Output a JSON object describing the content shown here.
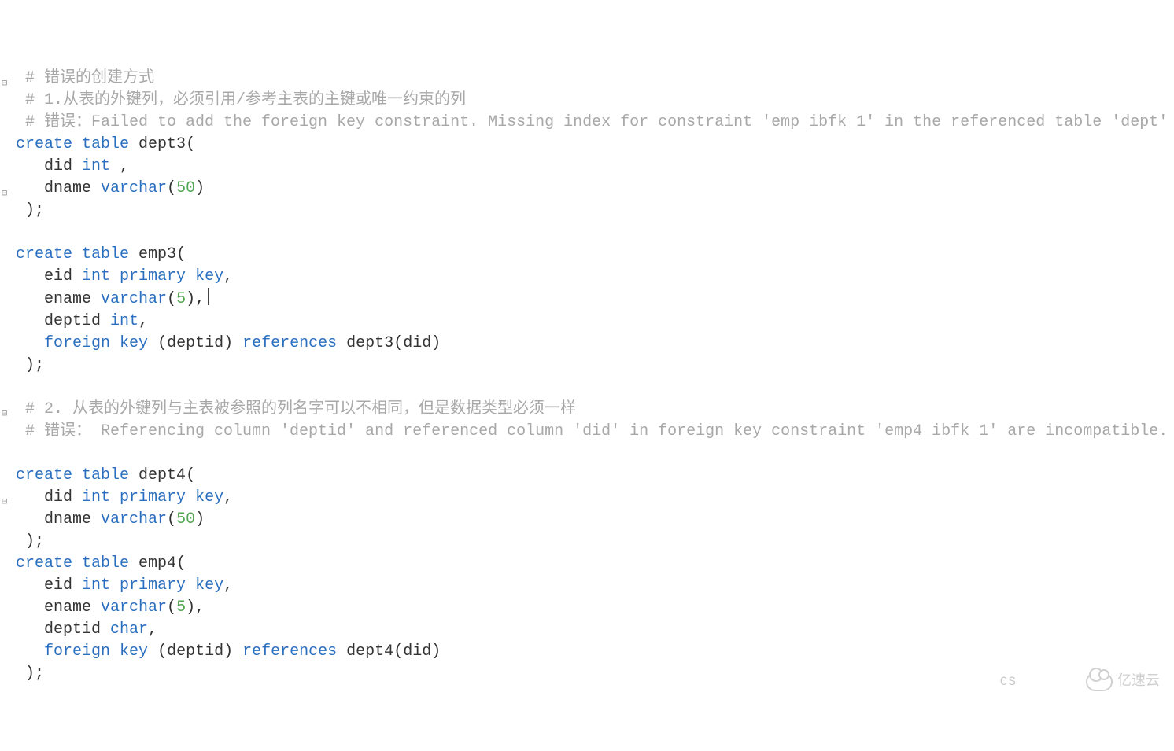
{
  "fold_markers": {
    "glyph": "⊟",
    "lines": [
      4,
      9,
      19,
      23
    ]
  },
  "code_lines": [
    [
      {
        "cls": "c-comment",
        "txt": " # 错误的创建方式"
      }
    ],
    [
      {
        "cls": "c-comment",
        "txt": " # 1.从表的外键列，必须引用/参考主表的主键或唯一约束的列"
      }
    ],
    [
      {
        "cls": "c-comment",
        "txt": " # 错误：Failed to add the foreign key constraint. Missing index for constraint 'emp_ibfk_1' in the referenced table 'dept'"
      }
    ],
    [
      {
        "cls": "c-keyword",
        "txt": "create"
      },
      {
        "cls": "c-ident",
        "txt": " "
      },
      {
        "cls": "c-keyword",
        "txt": "table"
      },
      {
        "cls": "c-ident",
        "txt": " dept3"
      },
      {
        "cls": "c-punct",
        "txt": "("
      }
    ],
    [
      {
        "cls": "c-ident",
        "txt": "   did "
      },
      {
        "cls": "c-keyword",
        "txt": "int"
      },
      {
        "cls": "c-ident",
        "txt": " "
      },
      {
        "cls": "c-punct",
        "txt": ","
      }
    ],
    [
      {
        "cls": "c-ident",
        "txt": "   dname "
      },
      {
        "cls": "c-keyword",
        "txt": "varchar"
      },
      {
        "cls": "c-punct",
        "txt": "("
      },
      {
        "cls": "c-number",
        "txt": "50"
      },
      {
        "cls": "c-punct",
        "txt": ")"
      }
    ],
    [
      {
        "cls": "c-punct",
        "txt": " );"
      }
    ],
    [
      {
        "cls": "c-ident",
        "txt": ""
      }
    ],
    [
      {
        "cls": "c-keyword",
        "txt": "create"
      },
      {
        "cls": "c-ident",
        "txt": " "
      },
      {
        "cls": "c-keyword",
        "txt": "table"
      },
      {
        "cls": "c-ident",
        "txt": " emp3"
      },
      {
        "cls": "c-punct",
        "txt": "("
      }
    ],
    [
      {
        "cls": "c-ident",
        "txt": "   eid "
      },
      {
        "cls": "c-keyword",
        "txt": "int"
      },
      {
        "cls": "c-ident",
        "txt": " "
      },
      {
        "cls": "c-keyword",
        "txt": "primary"
      },
      {
        "cls": "c-ident",
        "txt": " "
      },
      {
        "cls": "c-keyword",
        "txt": "key"
      },
      {
        "cls": "c-punct",
        "txt": ","
      }
    ],
    [
      {
        "cls": "c-ident",
        "txt": "   ename "
      },
      {
        "cls": "c-keyword",
        "txt": "varchar"
      },
      {
        "cls": "c-punct",
        "txt": "("
      },
      {
        "cls": "c-number",
        "txt": "5"
      },
      {
        "cls": "c-punct",
        "txt": "),"
      },
      {
        "cursor": true
      }
    ],
    [
      {
        "cls": "c-ident",
        "txt": "   deptid "
      },
      {
        "cls": "c-keyword",
        "txt": "int"
      },
      {
        "cls": "c-punct",
        "txt": ","
      }
    ],
    [
      {
        "cls": "c-ident",
        "txt": "   "
      },
      {
        "cls": "c-keyword",
        "txt": "foreign"
      },
      {
        "cls": "c-ident",
        "txt": " "
      },
      {
        "cls": "c-keyword",
        "txt": "key"
      },
      {
        "cls": "c-ident",
        "txt": " "
      },
      {
        "cls": "c-punct",
        "txt": "("
      },
      {
        "cls": "c-ident",
        "txt": "deptid"
      },
      {
        "cls": "c-punct",
        "txt": ")"
      },
      {
        "cls": "c-ident",
        "txt": " "
      },
      {
        "cls": "c-keyword",
        "txt": "references"
      },
      {
        "cls": "c-ident",
        "txt": " dept3"
      },
      {
        "cls": "c-punct",
        "txt": "("
      },
      {
        "cls": "c-ident",
        "txt": "did"
      },
      {
        "cls": "c-punct",
        "txt": ")"
      }
    ],
    [
      {
        "cls": "c-punct",
        "txt": " );"
      }
    ],
    [
      {
        "cls": "c-ident",
        "txt": ""
      }
    ],
    [
      {
        "cls": "c-comment",
        "txt": " # 2. 从表的外键列与主表被参照的列名字可以不相同，但是数据类型必须一样"
      }
    ],
    [
      {
        "cls": "c-comment",
        "txt": " # 错误： Referencing column 'deptid' and referenced column 'did' in foreign key constraint 'emp4_ibfk_1' are incompatible."
      }
    ],
    [
      {
        "cls": "c-ident",
        "txt": ""
      }
    ],
    [
      {
        "cls": "c-keyword",
        "txt": "create"
      },
      {
        "cls": "c-ident",
        "txt": " "
      },
      {
        "cls": "c-keyword",
        "txt": "table"
      },
      {
        "cls": "c-ident",
        "txt": " dept4"
      },
      {
        "cls": "c-punct",
        "txt": "("
      }
    ],
    [
      {
        "cls": "c-ident",
        "txt": "   did "
      },
      {
        "cls": "c-keyword",
        "txt": "int"
      },
      {
        "cls": "c-ident",
        "txt": " "
      },
      {
        "cls": "c-keyword",
        "txt": "primary"
      },
      {
        "cls": "c-ident",
        "txt": " "
      },
      {
        "cls": "c-keyword",
        "txt": "key"
      },
      {
        "cls": "c-punct",
        "txt": ","
      }
    ],
    [
      {
        "cls": "c-ident",
        "txt": "   dname "
      },
      {
        "cls": "c-keyword",
        "txt": "varchar"
      },
      {
        "cls": "c-punct",
        "txt": "("
      },
      {
        "cls": "c-number",
        "txt": "50"
      },
      {
        "cls": "c-punct",
        "txt": ")"
      }
    ],
    [
      {
        "cls": "c-punct",
        "txt": " );"
      }
    ],
    [
      {
        "cls": "c-keyword",
        "txt": "create"
      },
      {
        "cls": "c-ident",
        "txt": " "
      },
      {
        "cls": "c-keyword",
        "txt": "table"
      },
      {
        "cls": "c-ident",
        "txt": " emp4"
      },
      {
        "cls": "c-punct",
        "txt": "("
      }
    ],
    [
      {
        "cls": "c-ident",
        "txt": "   eid "
      },
      {
        "cls": "c-keyword",
        "txt": "int"
      },
      {
        "cls": "c-ident",
        "txt": " "
      },
      {
        "cls": "c-keyword",
        "txt": "primary"
      },
      {
        "cls": "c-ident",
        "txt": " "
      },
      {
        "cls": "c-keyword",
        "txt": "key"
      },
      {
        "cls": "c-punct",
        "txt": ","
      }
    ],
    [
      {
        "cls": "c-ident",
        "txt": "   ename "
      },
      {
        "cls": "c-keyword",
        "txt": "varchar"
      },
      {
        "cls": "c-punct",
        "txt": "("
      },
      {
        "cls": "c-number",
        "txt": "5"
      },
      {
        "cls": "c-punct",
        "txt": "),"
      }
    ],
    [
      {
        "cls": "c-ident",
        "txt": "   deptid "
      },
      {
        "cls": "c-keyword",
        "txt": "char"
      },
      {
        "cls": "c-punct",
        "txt": ","
      }
    ],
    [
      {
        "cls": "c-ident",
        "txt": "   "
      },
      {
        "cls": "c-keyword",
        "txt": "foreign"
      },
      {
        "cls": "c-ident",
        "txt": " "
      },
      {
        "cls": "c-keyword",
        "txt": "key"
      },
      {
        "cls": "c-ident",
        "txt": " "
      },
      {
        "cls": "c-punct",
        "txt": "("
      },
      {
        "cls": "c-ident",
        "txt": "deptid"
      },
      {
        "cls": "c-punct",
        "txt": ")"
      },
      {
        "cls": "c-ident",
        "txt": " "
      },
      {
        "cls": "c-keyword",
        "txt": "references"
      },
      {
        "cls": "c-ident",
        "txt": " dept4"
      },
      {
        "cls": "c-punct",
        "txt": "("
      },
      {
        "cls": "c-ident",
        "txt": "did"
      },
      {
        "cls": "c-punct",
        "txt": ")"
      }
    ],
    [
      {
        "cls": "c-punct",
        "txt": " );"
      }
    ]
  ],
  "watermark": {
    "brand": "亿速云",
    "partial": "CS"
  }
}
